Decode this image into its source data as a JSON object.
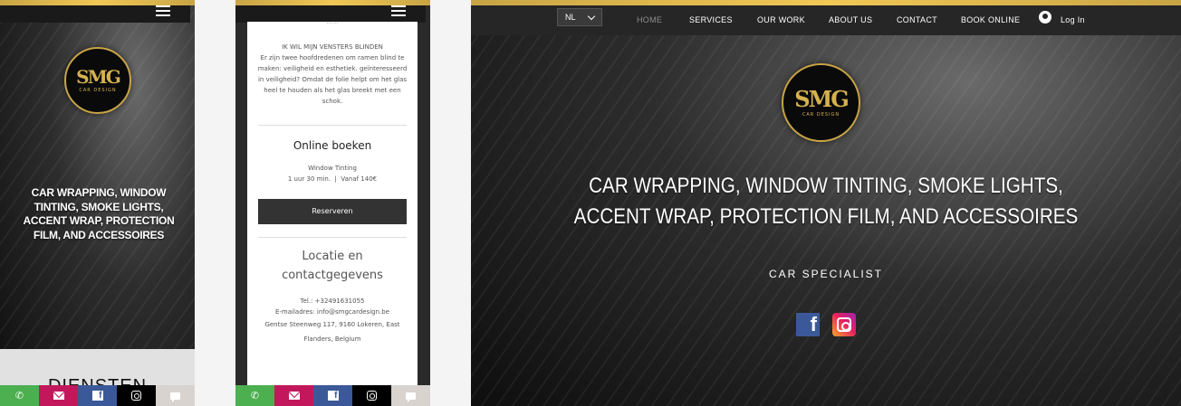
{
  "colors": {
    "gold": "#c9a445",
    "dark": "#262626",
    "phone": "#4caf50",
    "mail": "#c2185b",
    "facebook": "#3b5998",
    "instagram": "#000000",
    "chat": "#d8d3cf"
  },
  "logo": {
    "mark": "SMG",
    "subtitle": "CAR DESIGN"
  },
  "mobile1": {
    "headline": "CAR WRAPPING, WINDOW TINTING, SMOKE LIGHTS, ACCENT WRAP, PROTECTION FILM, AND ACCESSOIRES",
    "section_peek": "DIENSTEN"
  },
  "mobile2": {
    "top_cut": "......",
    "heading": "IK WIL MIJN VENSTERS BLINDEN",
    "body": "Er zijn twee hoofdredenen om ramen blind te maken: veiligheid en esthetiek. geïnteresseerd in veiligheid? Omdat de folie helpt om het glas heel te houden als het glas breekt met een schok.",
    "booking": {
      "title": "Online boeken",
      "service": "Window Tinting",
      "duration": "1 uur 30 min.",
      "separator": "|",
      "price": "Vanaf 140€",
      "button": "Reserveren"
    },
    "contact": {
      "title": "Locatie en contactgegevens",
      "phone": "Tel.: +32491631055",
      "email": "E-mailadres: info@smgcardesign.be",
      "address": "Gentse Steenweg 117, 9160 Lokeren, East Flanders, Belgium"
    }
  },
  "desktop": {
    "nav": {
      "language": "NL",
      "items": [
        "HOME",
        "SERVICES",
        "OUR WORK",
        "ABOUT US",
        "CONTACT",
        "BOOK ONLINE"
      ],
      "login": "Log In"
    },
    "headline_line1": "CAR WRAPPING, WINDOW TINTING, SMOKE LIGHTS,",
    "headline_line2": "ACCENT WRAP, PROTECTION FILM, AND ACCESSOIRES",
    "tagline": "CAR SPECIALIST"
  }
}
